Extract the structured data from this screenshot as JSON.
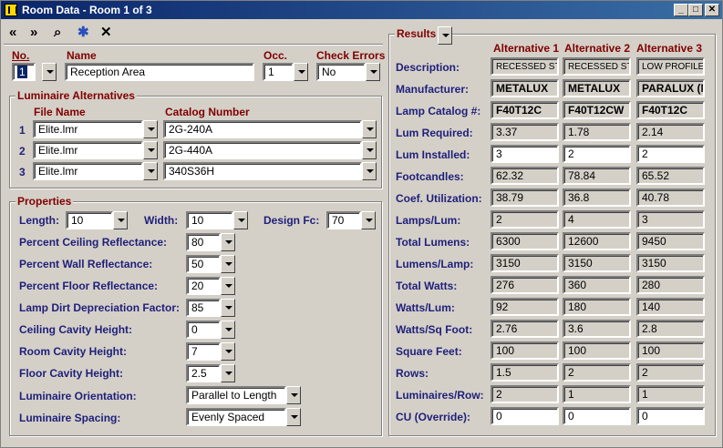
{
  "window": {
    "title": "Room Data - Room 1 of 3",
    "minimize": "_",
    "maximize": "□",
    "close": "✕"
  },
  "toolbar": {
    "prev": "«",
    "next": "»",
    "find": "⌕",
    "new": "✱",
    "delete": "✕"
  },
  "room": {
    "no_label": "No.",
    "no_value": "1",
    "name_label": "Name",
    "name_value": "Reception Area",
    "occ_label": "Occ.",
    "occ_value": "1",
    "check_label": "Check Errors",
    "check_value": "No"
  },
  "luminaires": {
    "title": "Luminaire Alternatives",
    "file_header": "File Name",
    "catalog_header": "Catalog Number",
    "rows": [
      {
        "n": "1",
        "file": "Elite.lmr",
        "catalog": "2G-240A"
      },
      {
        "n": "2",
        "file": "Elite.lmr",
        "catalog": "2G-440A"
      },
      {
        "n": "3",
        "file": "Elite.lmr",
        "catalog": "340S36H"
      }
    ]
  },
  "properties": {
    "title": "Properties",
    "length_label": "Length:",
    "length_value": "10",
    "width_label": "Width:",
    "width_value": "10",
    "fc_label": "Design Fc:",
    "fc_value": "70",
    "rows": [
      {
        "label": "Percent Ceiling Reflectance:",
        "value": "80"
      },
      {
        "label": "Percent Wall Reflectance:",
        "value": "50"
      },
      {
        "label": "Percent Floor Reflectance:",
        "value": "20"
      },
      {
        "label": "Lamp Dirt Depreciation Factor:",
        "value": "85"
      },
      {
        "label": "Ceiling Cavity Height:",
        "value": "0"
      },
      {
        "label": "Room Cavity Height:",
        "value": "7"
      },
      {
        "label": "Floor Cavity Height:",
        "value": "2.5"
      },
      {
        "label": "Luminaire Orientation:",
        "value": "Parallel to Length"
      },
      {
        "label": "Luminaire Spacing:",
        "value": "Evenly Spaced"
      }
    ]
  },
  "results": {
    "title": "Results",
    "alt_headers": [
      "Alternative 1",
      "Alternative 2",
      "Alternative 3"
    ],
    "rows": [
      {
        "label": "Description:",
        "small": true,
        "values": [
          "RECESSED ST",
          "RECESSED ST",
          "LOW PROFILE"
        ]
      },
      {
        "label": "Manufacturer:",
        "bold": true,
        "values": [
          "METALUX",
          "METALUX",
          "PARALUX (ME"
        ]
      },
      {
        "label": "Lamp Catalog #:",
        "bold": true,
        "values": [
          "F40T12C",
          "F40T12CW",
          "F40T12C"
        ]
      },
      {
        "label": "Lum Required:",
        "values": [
          "3.37",
          "1.78",
          "2.14"
        ]
      },
      {
        "label": "Lum Installed:",
        "white": true,
        "values": [
          "3",
          "2",
          "2"
        ]
      },
      {
        "label": "Footcandles:",
        "values": [
          "62.32",
          "78.84",
          "65.52"
        ]
      },
      {
        "label": "Coef. Utilization:",
        "values": [
          "38.79",
          "36.8",
          "40.78"
        ]
      },
      {
        "label": "Lamps/Lum:",
        "values": [
          "2",
          "4",
          "3"
        ]
      },
      {
        "label": "Total Lumens:",
        "values": [
          "6300",
          "12600",
          "9450"
        ]
      },
      {
        "label": "Lumens/Lamp:",
        "values": [
          "3150",
          "3150",
          "3150"
        ]
      },
      {
        "label": "Total Watts:",
        "values": [
          "276",
          "360",
          "280"
        ]
      },
      {
        "label": "Watts/Lum:",
        "values": [
          "92",
          "180",
          "140"
        ]
      },
      {
        "label": "Watts/Sq Foot:",
        "values": [
          "2.76",
          "3.6",
          "2.8"
        ]
      },
      {
        "label": "Square Feet:",
        "values": [
          "100",
          "100",
          "100"
        ]
      },
      {
        "label": "Rows:",
        "values": [
          "1.5",
          "2",
          "2"
        ]
      },
      {
        "label": "Luminaires/Row:",
        "values": [
          "2",
          "1",
          "1"
        ]
      },
      {
        "label": "CU (Override):",
        "white": true,
        "values": [
          "0",
          "0",
          "0"
        ]
      }
    ]
  }
}
